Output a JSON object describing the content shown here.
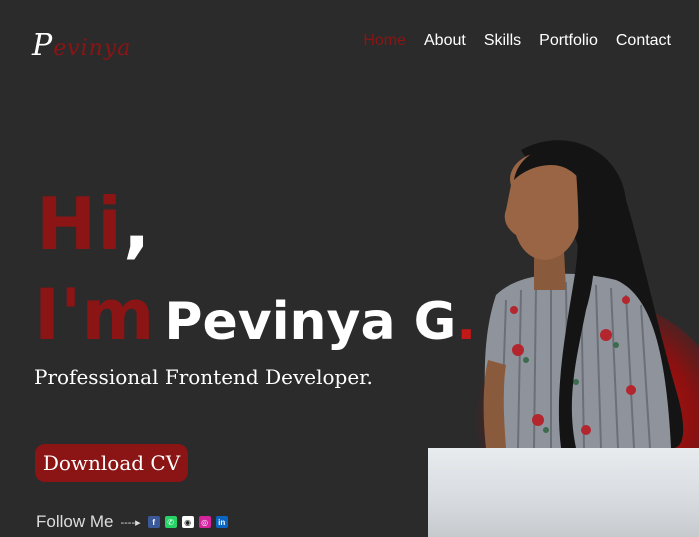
{
  "header": {
    "logo_first": "P",
    "logo_rest": "evinya",
    "nav": [
      "Home",
      "About",
      "Skills",
      "Portfolio",
      "Contact"
    ],
    "active_nav": "Home"
  },
  "hero": {
    "hi": "Hi",
    "hi_comma": ",",
    "im": "I'm",
    "name": "Pevinya G",
    "name_dot": ".",
    "subtitle": "Professional Frontend Developer.",
    "cv_button": "Download CV",
    "follow_label": "Follow Me",
    "social_icons": [
      "facebook-icon",
      "whatsapp-icon",
      "github-icon",
      "instagram-icon",
      "linkedin-icon"
    ]
  },
  "colors": {
    "background": "#2b2b2b",
    "accent": "#8b1414",
    "text": "#ffffff"
  }
}
